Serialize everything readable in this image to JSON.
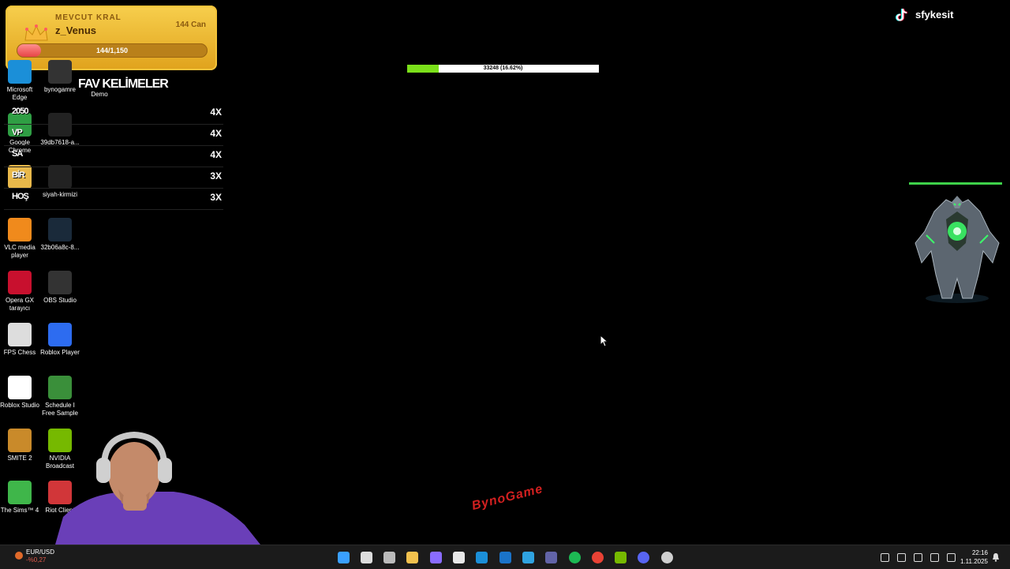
{
  "king": {
    "label": "MEVCUT KRAL",
    "name": "z_Venus",
    "hp_text": "144 Can",
    "bar_text": "144/1,150",
    "bar_fraction": 0.125
  },
  "fav": {
    "title": "FAV KELİMELER",
    "rows": [
      {
        "word": "2050",
        "count": "4X"
      },
      {
        "word": "VP",
        "count": "4X"
      },
      {
        "word": "SA",
        "count": "4X"
      },
      {
        "word": "BİR",
        "count": "3X"
      },
      {
        "word": "HOŞ",
        "count": "3X"
      }
    ]
  },
  "progress": {
    "text": "33248 (16.62%)",
    "fraction": 0.1662
  },
  "tiktok": {
    "name": "sfykesit",
    "icon": "tiktok-icon"
  },
  "desktop": {
    "col1": [
      {
        "label": "Microsoft Edge",
        "icon": "edge-icon",
        "color": "#1b8fd8"
      },
      {
        "label": "Google Chrome",
        "icon": "chrome-icon",
        "color": "#2f9e44"
      },
      {
        "label": "",
        "icon": "folder-icon",
        "color": "#e8b84a"
      },
      {
        "label": "VLC media player",
        "icon": "vlc-icon",
        "color": "#f08a1c"
      },
      {
        "label": "Opera GX tarayıcı",
        "icon": "opera-gx-icon",
        "color": "#c8102e"
      },
      {
        "label": "FPS Chess",
        "icon": "chess-icon",
        "color": "#dddddd"
      },
      {
        "label": "Roblox Studio",
        "icon": "roblox-studio-icon",
        "color": "#ffffff"
      },
      {
        "label": "SMITE 2",
        "icon": "smite-icon",
        "color": "#c98a2a"
      },
      {
        "label": "The Sims™ 4",
        "icon": "sims-icon",
        "color": "#3fb64a"
      }
    ],
    "col2": [
      {
        "label": "bynogamre",
        "icon": "file-icon",
        "color": "#333333"
      },
      {
        "label": "39db7618-a...",
        "icon": "image-file-icon",
        "color": "#222222"
      },
      {
        "label": "siyah-kirmizi",
        "icon": "image-file-icon",
        "color": "#222222"
      },
      {
        "label": "32b06a8c-8...",
        "icon": "image-file-icon",
        "color": "#1a2a3a"
      },
      {
        "label": "OBS Studio",
        "icon": "obs-icon",
        "color": "#333333"
      },
      {
        "label": "Roblox Player",
        "icon": "roblox-icon",
        "color": "#2d6cf0"
      },
      {
        "label": "Schedule I Free Sample",
        "icon": "schedule-icon",
        "color": "#3a8f3a"
      },
      {
        "label": "NVIDIA Broadcast",
        "icon": "nvidia-icon",
        "color": "#76b900"
      },
      {
        "label": "Riot Client",
        "icon": "riot-icon",
        "color": "#d13639"
      }
    ],
    "demo_label": "Demo"
  },
  "watermark": "BynoGame",
  "taskbar": {
    "stock_name": "EUR/USD",
    "stock_delta": "-%0,27",
    "apps": [
      "windows-start-icon",
      "search-icon",
      "task-view-icon",
      "file-explorer-icon",
      "copilot-icon",
      "store-icon",
      "edge-icon",
      "outlook-icon",
      "photos-icon",
      "teams-icon",
      "spotify-icon",
      "chrome-icon",
      "nvidia-icon",
      "discord-icon",
      "steam-icon"
    ],
    "time": "22:16",
    "date": "1.11.2025"
  }
}
